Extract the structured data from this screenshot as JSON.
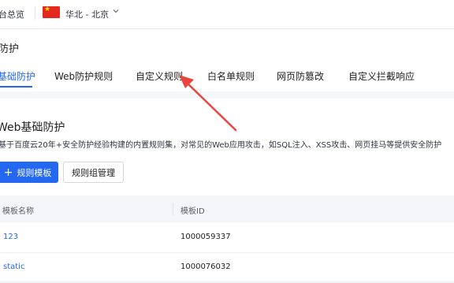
{
  "topbar": {
    "overview": "台总览",
    "region": "华北 - 北京",
    "flag_icon": "china-flag-icon",
    "chevron_icon": "chevron-down-icon"
  },
  "page": {
    "title": "防护"
  },
  "tabs": [
    {
      "label": "基础防护",
      "active": true
    },
    {
      "label": "Web防护规则",
      "active": false
    },
    {
      "label": "自定义规则",
      "active": false
    },
    {
      "label": "白名单规则",
      "active": false
    },
    {
      "label": "网页防篡改",
      "active": false
    },
    {
      "label": "自定义拦截响应",
      "active": false
    }
  ],
  "section": {
    "title": "Web基础防护",
    "description": "基于百度云20年+安全防护经验构建的内置规则集，对常见的Web应用攻击，如SQL注入、XSS攻击、网页挂马等提供安全防护",
    "add_button_icon": "plus-icon",
    "add_button": "规则模板",
    "manage_button": "规则组管理"
  },
  "table": {
    "columns": [
      "模板名称",
      "模板ID"
    ],
    "rows": [
      {
        "name": "123",
        "id": "1000059337"
      },
      {
        "name": "static",
        "id": "1000076032"
      }
    ]
  },
  "colors": {
    "accent": "#2468f2",
    "annotation_arrow": "#e8453c"
  }
}
